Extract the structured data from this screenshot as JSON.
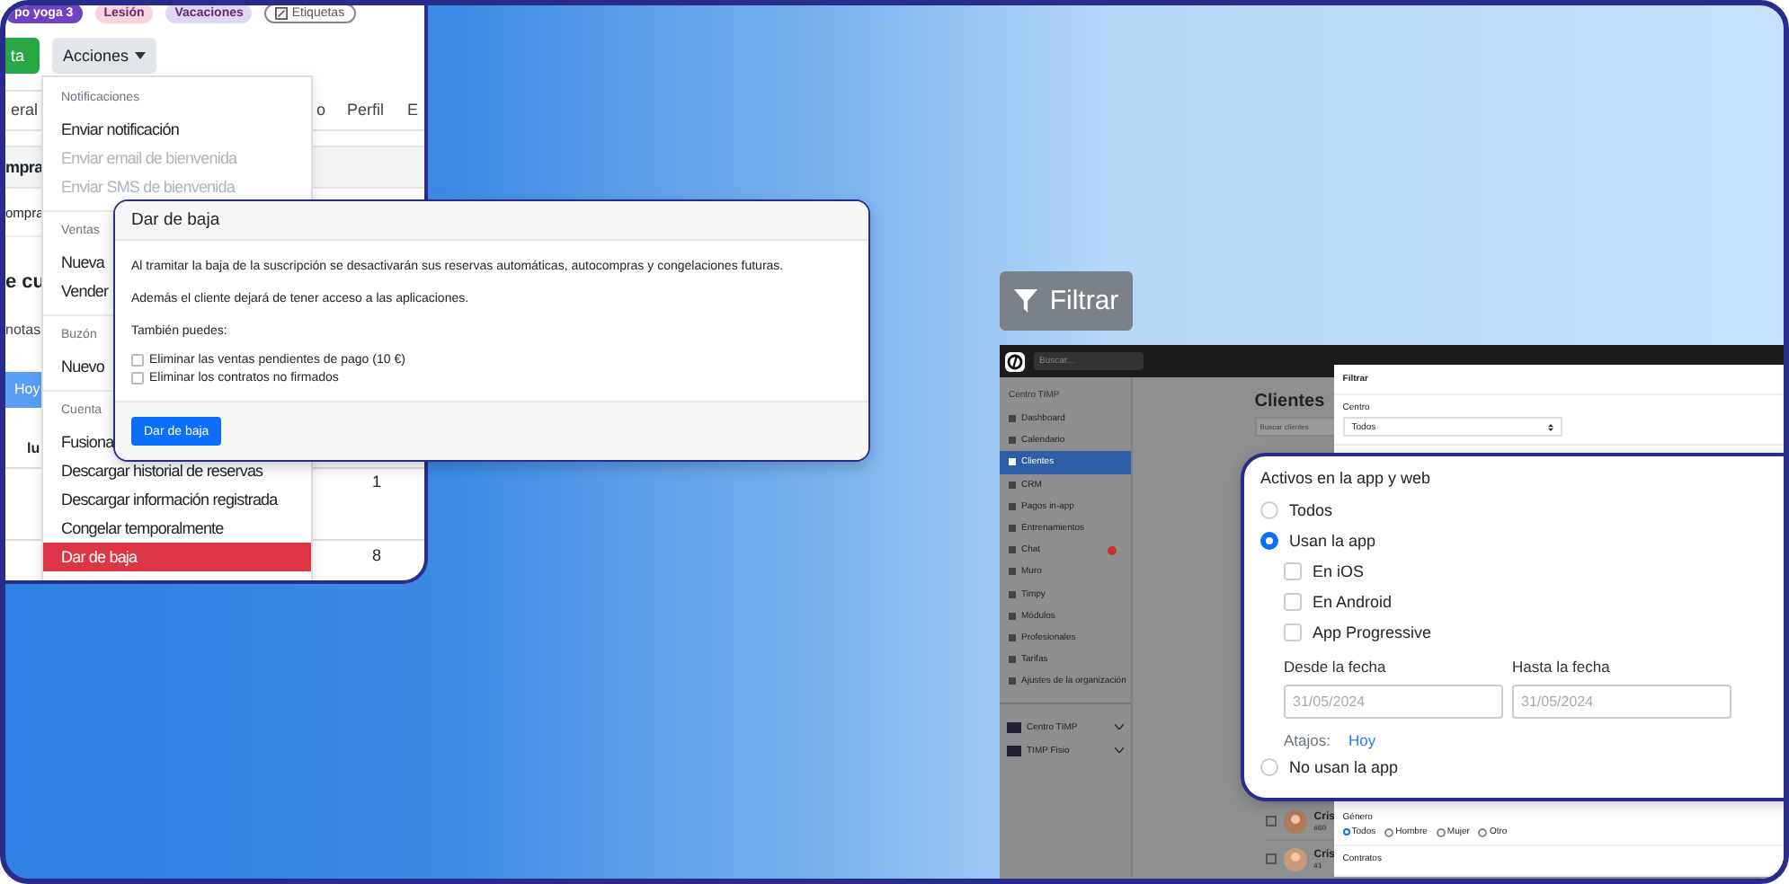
{
  "tags": [
    {
      "label": "po yoga 3",
      "color": "#6f42c1"
    },
    {
      "label": "Lesión",
      "color": "#f9d3dd"
    },
    {
      "label": "Vacaciones",
      "color": "#e0d6f5"
    }
  ],
  "labels_button": "Etiquetas",
  "primary_button": "ta",
  "actions_button": "Acciones",
  "tabs": [
    {
      "label": "eral",
      "selected": true
    },
    {
      "label": "o",
      "selected": false
    },
    {
      "label": "Perfil",
      "selected": false
    },
    {
      "label": "E",
      "selected": false
    }
  ],
  "page_fragments": {
    "section_title": "mpra",
    "section_row": "ompra",
    "heading": "e cu",
    "notes": "notas",
    "today_button": "Hoy",
    "column_header": "lu",
    "values": [
      "1",
      "8"
    ]
  },
  "menu": {
    "sections": [
      {
        "header": "Notificaciones",
        "items": [
          {
            "label": "Enviar notificación",
            "disabled": false,
            "selected": false
          },
          {
            "label": "Enviar email de bienvenida",
            "disabled": true,
            "selected": false
          },
          {
            "label": "Enviar SMS de bienvenida",
            "disabled": true,
            "selected": false
          }
        ]
      },
      {
        "header": "Ventas",
        "items": [
          {
            "label": "Nueva",
            "disabled": false,
            "selected": false
          },
          {
            "label": "Vender",
            "disabled": false,
            "selected": false
          }
        ]
      },
      {
        "header": "Buzón",
        "items": [
          {
            "label": "Nuevo",
            "disabled": false,
            "selected": false
          }
        ]
      },
      {
        "header": "Cuenta",
        "items": [
          {
            "label": "Fusiona",
            "disabled": false,
            "selected": false
          },
          {
            "label": "Descargar historial de reservas",
            "disabled": false,
            "selected": false
          },
          {
            "label": "Descargar información registrada",
            "disabled": false,
            "selected": false
          },
          {
            "label": "Congelar temporalmente",
            "disabled": false,
            "selected": false
          },
          {
            "label": "Dar de baja",
            "disabled": false,
            "selected": true
          }
        ]
      }
    ]
  },
  "modal": {
    "title": "Dar de baja",
    "paragraphs": [
      "Al tramitar la baja de la suscripción se desactivarán sus reservas automáticas, autocompras y congelaciones futuras.",
      "Además el cliente dejará de tener acceso a las aplicaciones.",
      "También puedes:"
    ],
    "options": [
      {
        "label": "Eliminar las ventas pendientes de pago (10 €)",
        "checked": false
      },
      {
        "label": "Eliminar los contratos no firmados",
        "checked": false
      }
    ],
    "button": "Dar de baja"
  },
  "filter_button": "Filtrar",
  "app": {
    "search_placeholder": "Buscar...",
    "sidebar": {
      "heading": "Centro TIMP",
      "items": [
        {
          "label": "Dashboard",
          "selected": false,
          "alert": false
        },
        {
          "label": "Calendario",
          "selected": false,
          "alert": false
        },
        {
          "label": "Clientes",
          "selected": true,
          "alert": false
        },
        {
          "label": "CRM",
          "selected": false,
          "alert": false
        },
        {
          "label": "Pagos in-app",
          "selected": false,
          "alert": false
        },
        {
          "label": "Entrenamientos",
          "selected": false,
          "alert": false
        },
        {
          "label": "Chat",
          "selected": false,
          "alert": true
        },
        {
          "label": "Muro",
          "selected": false,
          "alert": false
        },
        {
          "label": "Timpy",
          "selected": false,
          "alert": false
        },
        {
          "label": "Módulos",
          "selected": false,
          "alert": false
        },
        {
          "label": "Profesionales",
          "selected": false,
          "alert": false
        },
        {
          "label": "Tarifas",
          "selected": false,
          "alert": false
        },
        {
          "label": "Ajustes de la organización",
          "selected": false,
          "alert": false
        }
      ],
      "centers": [
        {
          "label": "Centro TIMP"
        },
        {
          "label": "TIMP Fisio"
        }
      ]
    },
    "main": {
      "title": "Clientes",
      "search_placeholder": "Buscar clientes",
      "rows": [
        {
          "name": "Cris",
          "number": "#60",
          "checked": false
        },
        {
          "name": "Cris",
          "number": "#1",
          "checked": false
        }
      ]
    },
    "filter_panel": {
      "title": "Filtrar",
      "center_label": "Centro",
      "center_value": "Todos",
      "gender_label": "Género",
      "gender_options": [
        {
          "label": "Todos",
          "selected": true
        },
        {
          "label": "Hombre",
          "selected": false
        },
        {
          "label": "Mujer",
          "selected": false
        },
        {
          "label": "Otro",
          "selected": false
        }
      ],
      "contracts_label": "Contratos"
    }
  },
  "popup": {
    "title": "Activos en la app y web",
    "options": [
      {
        "label": "Todos",
        "selected": false
      },
      {
        "label": "Usan la app",
        "selected": true
      }
    ],
    "platforms": [
      {
        "label": "En iOS",
        "checked": false
      },
      {
        "label": "En Android",
        "checked": false
      },
      {
        "label": "App Progressive",
        "checked": false
      }
    ],
    "from_label": "Desde la fecha",
    "from_placeholder": "31/05/2024",
    "to_label": "Hasta la fecha",
    "to_placeholder": "31/05/2024",
    "shortcuts_label": "Atajos:",
    "shortcut": "Hoy",
    "last_option": {
      "label": "No usan la app",
      "selected": false
    }
  }
}
